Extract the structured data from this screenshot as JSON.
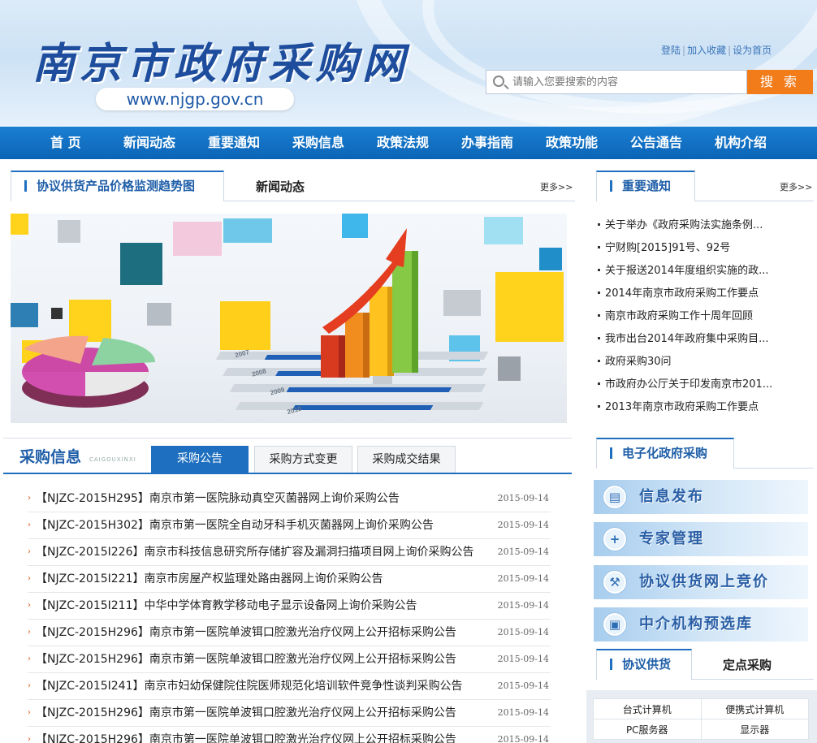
{
  "header": {
    "logo_text": "南京市政府采购网",
    "logo_url": "www.njgp.gov.cn",
    "top_links": [
      "登陆",
      "加入收藏",
      "设为首页"
    ],
    "search_placeholder": "请输入您要搜索的内容",
    "search_button": "搜 索"
  },
  "nav": [
    "首 页",
    "新闻动态",
    "重要通知",
    "采购信息",
    "政策法规",
    "办事指南",
    "政策功能",
    "公告通告",
    "机构介绍"
  ],
  "price_section": {
    "active_tab": "协议供货产品价格监测趋势图",
    "tab2": "新闻动态",
    "more": "更多>>"
  },
  "banner": {
    "year_labels": [
      "2007",
      "2008",
      "2009",
      "2010"
    ]
  },
  "notice_section": {
    "tab": "重要通知",
    "more": "更多>>",
    "items": [
      "关于举办《政府采购法实施条例...",
      "宁财购[2015]91号、92号",
      "关于报送2014年度组织实施的政...",
      "2014年南京市政府采购工作要点",
      "南京市政府采购工作十周年回顾",
      "我市出台2014年政府集中采购目...",
      "政府采购30问",
      "市政府办公厅关于印发南京市201...",
      "2013年南京市政府采购工作要点"
    ]
  },
  "procurement": {
    "title": "采购信息",
    "title_en": "CAIGOUXINXI",
    "tabs": [
      "采购公告",
      "采购方式变更",
      "采购成交结果"
    ],
    "items": [
      {
        "title": "【NJZC-2015H295】南京市第一医院脉动真空灭菌器网上询价采购公告",
        "date": "2015-09-14"
      },
      {
        "title": "【NJZC-2015H302】南京市第一医院全自动牙科手机灭菌器网上询价采购公告",
        "date": "2015-09-14"
      },
      {
        "title": "【NJZC-2015I226】南京市科技信息研究所存储扩容及漏洞扫描项目网上询价采购公告",
        "date": "2015-09-14"
      },
      {
        "title": "【NJZC-2015I221】南京市房屋产权监理处路由器网上询价采购公告",
        "date": "2015-09-14"
      },
      {
        "title": "【NJZC-2015I211】中华中学体育教学移动电子显示设备网上询价采购公告",
        "date": "2015-09-14"
      },
      {
        "title": "【NJZC-2015H296】南京市第一医院单波铒口腔激光治疗仪网上公开招标采购公告",
        "date": "2015-09-14"
      },
      {
        "title": "【NJZC-2015H296】南京市第一医院单波铒口腔激光治疗仪网上公开招标采购公告",
        "date": "2015-09-14"
      },
      {
        "title": "【NJZC-2015I241】南京市妇幼保健院住院医师规范化培训软件竞争性谈判采购公告",
        "date": "2015-09-14"
      },
      {
        "title": "【NJZC-2015H296】南京市第一医院单波铒口腔激光治疗仪网上公开招标采购公告",
        "date": "2015-09-14"
      },
      {
        "title": "【NJZC-2015H296】南京市第一医院单波铒口腔激光治疗仪网上公开招标采购公告",
        "date": "2015-09-14"
      }
    ]
  },
  "egov": {
    "tab": "电子化政府采购",
    "buttons": [
      "信息发布",
      "专家管理",
      "协议供货网上竞价",
      "中介机构预选库"
    ]
  },
  "supply": {
    "tab_active": "协议供货",
    "tab2": "定点采购",
    "cells": [
      "台式计算机",
      "便携式计算机",
      "PC服务器",
      "显示器"
    ]
  }
}
